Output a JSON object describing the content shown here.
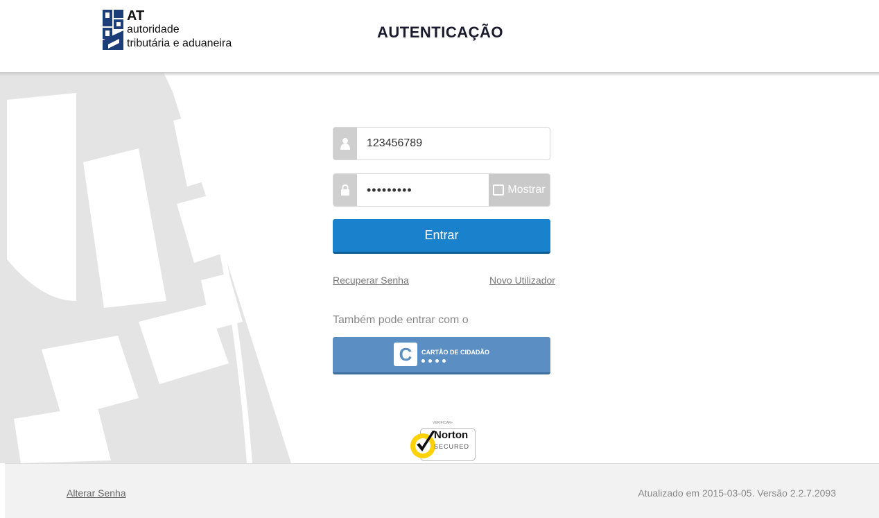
{
  "header": {
    "logo": {
      "abbr": "AT",
      "line1": "autoridade",
      "line2": "tributária e aduaneira"
    },
    "title": "AUTENTICAÇÃO"
  },
  "form": {
    "username": {
      "value": "123456789",
      "icon": "user-icon"
    },
    "password": {
      "value": "•••••••••",
      "icon": "lock-icon",
      "show_label": "Mostrar"
    },
    "submit_label": "Entrar",
    "recover_label": "Recuperar Senha",
    "new_user_label": "Novo Utilizador",
    "alt_login_text": "Também pode entrar com o",
    "citizen_card": {
      "label": "CARTÃO DE CIDADÃO",
      "icon_letter": "C"
    }
  },
  "norton": {
    "verify_label": "VERIFICAR»",
    "name": "Norton",
    "tm": "™",
    "secured": "SECURED"
  },
  "footer": {
    "change_password_label": "Alterar Senha",
    "version_text": "Atualizado em 2015-03-05. Versão 2.2.7.2093"
  },
  "colors": {
    "primary": "#1a82cc",
    "citizen_card": "#5b8fc3",
    "addon_gray": "#cfcfcf",
    "footer_bg": "#f2f2f2"
  }
}
